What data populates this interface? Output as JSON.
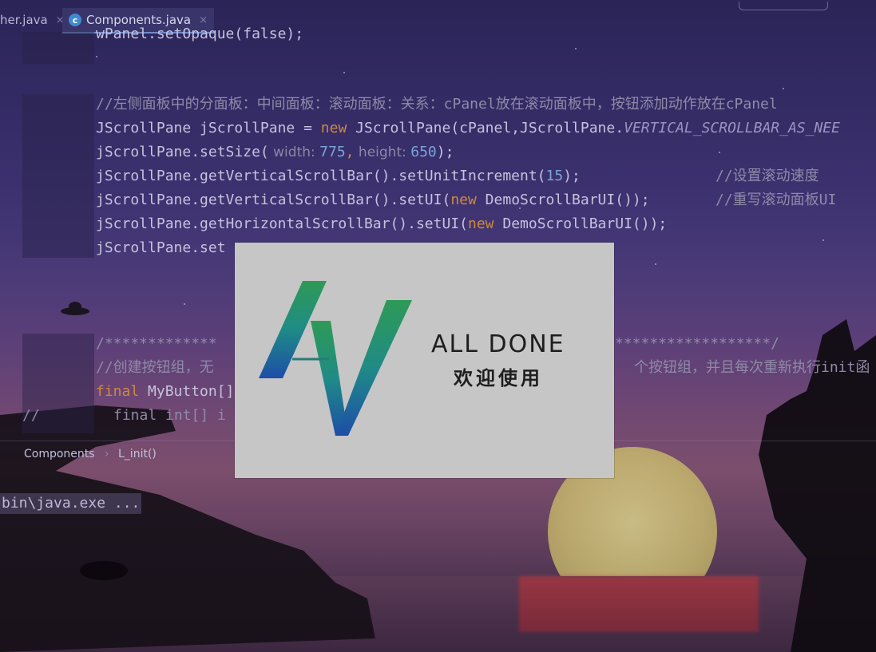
{
  "tabs": [
    {
      "label": "her.java",
      "close": "×"
    },
    {
      "label": "Components.java",
      "icon": "c-class-icon",
      "icon_glyph": "c",
      "close": "×"
    }
  ],
  "code_lines": {
    "l0": "wPanel.setOpaque(false);",
    "l1": "//左侧面板中的分面板：中间面板：滚动面板：关系：cPanel放在滚动面板中，按钮添加动作放在cPanel",
    "l2_a": "JScrollPane jScrollPane = ",
    "l2_kw": "new",
    "l2_b": " JScrollPane(cPanel,JScrollPane.",
    "l2_it": "VERTICAL_SCROLLBAR_AS_NEE",
    "l3_a": "jScrollPane.setSize(",
    "l3_h1": " width: ",
    "l3_n1": "775",
    "l3_c": ",",
    "l3_h2": " height: ",
    "l3_n2": "650",
    "l3_e": ");",
    "l4_a": "jScrollPane.getVerticalScrollBar().setUnitIncrement(",
    "l4_n": "15",
    "l4_e": ");",
    "l4_cmt": "//设置滚动速度",
    "l5_a": "jScrollPane.getVerticalScrollBar().setUI(",
    "l5_kw": "new",
    "l5_b": " DemoScrollBarUI());",
    "l5_cmt": "//重写滚动面板UI",
    "l6_a": "jScrollPane.getHorizontalScrollBar().setUI(",
    "l6_kw": "new",
    "l6_b": " DemoScrollBarUI());",
    "l7": "jScrollPane.set",
    "l8_a": "/*************",
    "l8_b": "******************/",
    "l9_a": "//创建按钮组，无",
    "l9_b": "个按钮组，并且每次重新执行init函",
    "l10_kw": "final",
    "l10_b": " MyButton[]",
    "l11_a": "//",
    "l11_b": "final int[] i"
  },
  "breadcrumb": {
    "item1": "Components",
    "sep": "›",
    "item2": "L_init()"
  },
  "run_output": "bin\\java.exe ...",
  "splash": {
    "brand_en": "ALL DONE",
    "brand_cn": "欢迎使用"
  }
}
